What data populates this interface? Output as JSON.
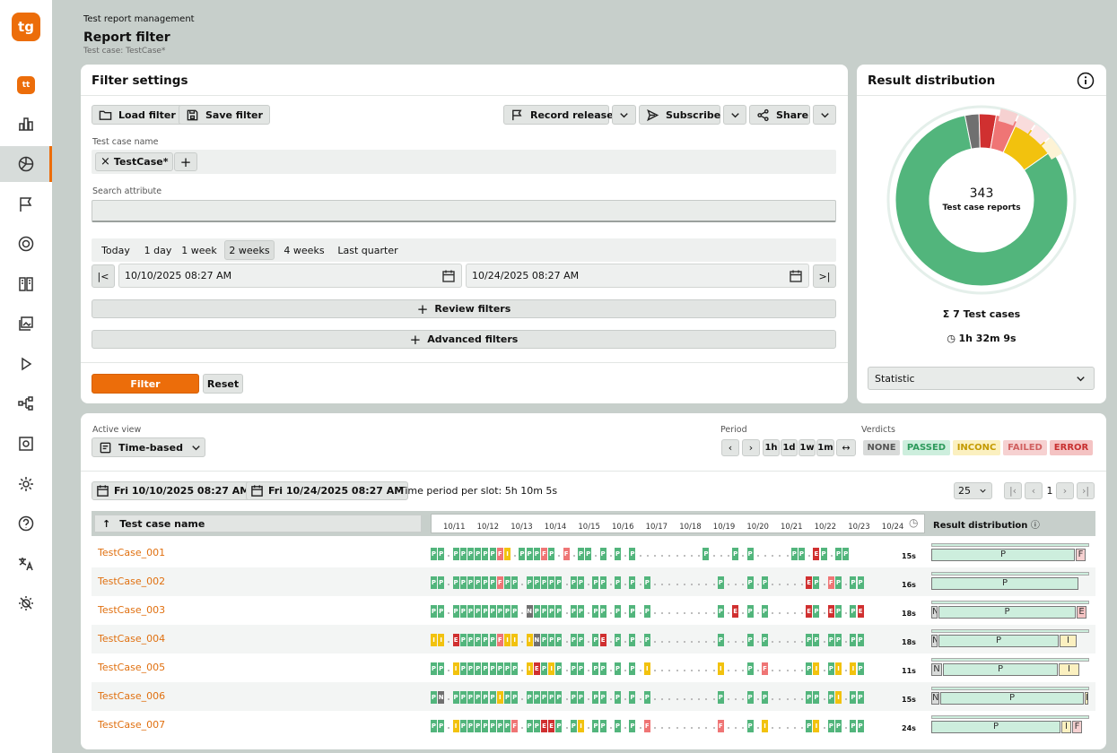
{
  "app": {
    "logo": "tg",
    "logo_small": "tt"
  },
  "nav": [
    {
      "icon": "bar-chart-icon",
      "active": false
    },
    {
      "icon": "pie-chart-icon",
      "active": true
    },
    {
      "icon": "flag-icon",
      "active": false
    },
    {
      "icon": "target-icon",
      "active": false
    },
    {
      "icon": "book-icon",
      "active": false
    },
    {
      "icon": "gallery-icon",
      "active": false
    },
    {
      "icon": "play-icon",
      "active": false
    },
    {
      "icon": "hierarchy-icon",
      "active": false
    },
    {
      "icon": "settings-box-icon",
      "active": false
    },
    {
      "icon": "gear-icon",
      "active": false
    },
    {
      "icon": "help-icon",
      "active": false
    },
    {
      "icon": "translate-icon",
      "active": false
    },
    {
      "icon": "theme-icon",
      "active": false
    }
  ],
  "header": {
    "breadcrumb": "Test report management",
    "title": "Report filter",
    "subtitle": "Test case: TestCase*"
  },
  "filter": {
    "title": "Filter settings",
    "load": "Load filter",
    "save": "Save filter",
    "record": "Record release",
    "subscribe": "Subscribe",
    "share": "Share",
    "tc_label": "Test case name",
    "tc_chip": "TestCase*",
    "search_label": "Search attribute",
    "periods": [
      "Today",
      "1 day",
      "1 week",
      "2 weeks",
      "4 weeks",
      "Last quarter"
    ],
    "period_active": "2 weeks",
    "start": "10/10/2025 08:27 AM",
    "end": "10/24/2025 08:27 AM",
    "review": "Review filters",
    "advanced": "Advanced filters",
    "filter_btn": "Filter",
    "reset_btn": "Reset"
  },
  "dist": {
    "title": "Result distribution",
    "total": "343",
    "total_label": "Test case reports",
    "cases": "7 Test cases",
    "duration": "1h 32m 9s",
    "select": "Statistic",
    "slices": [
      {
        "name": "PASSED",
        "value": 280,
        "color": "#52b57c"
      },
      {
        "name": "NONE",
        "value": 9,
        "color": "#707070"
      },
      {
        "name": "ERROR",
        "value": 11,
        "color": "#d03030"
      },
      {
        "name": "FAILED",
        "value": 14,
        "color": "#ef7575"
      },
      {
        "name": "INCONC",
        "value": 29,
        "color": "#f2c20e"
      }
    ]
  },
  "view": {
    "active_label": "Active view",
    "active": "Time-based",
    "period_label": "Period",
    "period_btns": [
      "1h",
      "1d",
      "1w",
      "1m"
    ],
    "verdicts_label": "Verdicts",
    "verdicts": [
      {
        "label": "NONE",
        "bg": "#d8dad9",
        "fg": "#555"
      },
      {
        "label": "PASSED",
        "bg": "#cdeedd",
        "fg": "#2d9a5c"
      },
      {
        "label": "INCONC",
        "bg": "#fbf0c0",
        "fg": "#c49a00"
      },
      {
        "label": "FAILED",
        "bg": "#f6d1d1",
        "fg": "#d06060"
      },
      {
        "label": "ERROR",
        "bg": "#f4c3c3",
        "fg": "#c83030"
      }
    ],
    "from": "Fri 10/10/2025 08:27 AM",
    "to": "Fri 10/24/2025 08:27 AM",
    "slot": "Time period per slot: 5h 10m 5s",
    "page_size": "25",
    "page": "1",
    "col_name": "Test case name",
    "col_dist": "Result distribution",
    "dates": [
      "10/11",
      "10/12",
      "10/13",
      "10/14",
      "10/15",
      "10/16",
      "10/17",
      "10/18",
      "10/19",
      "10/20",
      "10/21",
      "10/22",
      "10/23",
      "10/24"
    ]
  },
  "rows": [
    {
      "name": "TestCase_001",
      "dur": "15s",
      "seq": "PP.PPPPPPFI.PPPFP.F.PP.P.P.P.........P...P.P.....PP.EP.PP",
      "dist": [
        [
          "",
          0.91,
          "#cdeedd"
        ],
        [
          "",
          0.02,
          "#f6d1d1"
        ],
        [
          "",
          0.05,
          "#f6d1d1"
        ]
      ],
      "dist_main": [
        [
          "P",
          0.91,
          "#cdeedd"
        ],
        [
          "F",
          0.06,
          "#f6d1d1"
        ]
      ]
    },
    {
      "name": "TestCase_002",
      "dur": "16s",
      "seq": "PP.PPPPPPFPP.PPPPP.PP.PP.P.P.P.........P...P.P.....EP.FP.PP",
      "dist": [],
      "dist_main": [
        [
          "P",
          0.93,
          "#cdeedd"
        ]
      ]
    },
    {
      "name": "TestCase_003",
      "dur": "18s",
      "seq": "PP.PPPPPPPPP.NPPPP.PP.PP.P.P.P.........P.E.P.P.....EP.EP.PE",
      "dist": [],
      "dist_main": [
        [
          "N",
          0.04,
          "#d8dad9"
        ],
        [
          "P",
          0.87,
          "#cdeedd"
        ],
        [
          "E",
          0.06,
          "#f4c3c3"
        ]
      ]
    },
    {
      "name": "TestCase_004",
      "dur": "18s",
      "seq": "II.EPPPPPFII.INPPP.PP.PE.P.P.P.........P...P.P.....PP.PP.PP",
      "dist": [],
      "dist_main": [
        [
          "N",
          0.04,
          "#d8dad9"
        ],
        [
          "P",
          0.76,
          "#cdeedd"
        ],
        [
          "I",
          0.11,
          "#fbf0c0"
        ]
      ]
    },
    {
      "name": "TestCase_005",
      "dur": "11s",
      "seq": "PP.IPPPPPPPP.IEPIP.PP.PP.P.P.I.........I...P.F.....PI.PI.IP",
      "dist": [],
      "dist_main": [
        [
          "N",
          0.07,
          "#d8dad9"
        ],
        [
          "P",
          0.73,
          "#cdeedd"
        ],
        [
          "I",
          0.13,
          "#fbf0c0"
        ]
      ]
    },
    {
      "name": "TestCase_006",
      "dur": "15s",
      "seq": "PN.PPPPPPIPP.PPPPP.PP.PP.P.P.P.........P...P.P.....PP.PI.PP",
      "dist": [],
      "dist_main": [
        [
          "N",
          0.05,
          "#d8dad9"
        ],
        [
          "P",
          0.91,
          "#cdeedd"
        ],
        [
          "I",
          0.02,
          "#fbf0c0"
        ]
      ]
    },
    {
      "name": "TestCase_007",
      "dur": "24s",
      "seq": "PP.IPPPPPPPF.PPEEP.PI.PP.P.P.F.........F...P.I.....PI.PP.PP",
      "dist": [],
      "dist_main": [
        [
          "P",
          0.82,
          "#cdeedd"
        ],
        [
          "I",
          0.06,
          "#fbf0c0"
        ],
        [
          "F",
          0.06,
          "#f6d1d1"
        ]
      ]
    }
  ],
  "legend": {
    "P": "#52b57c",
    "I": "#f2c20e",
    "F": "#ef7575",
    "E": "#d03030",
    "N": "#707070"
  }
}
